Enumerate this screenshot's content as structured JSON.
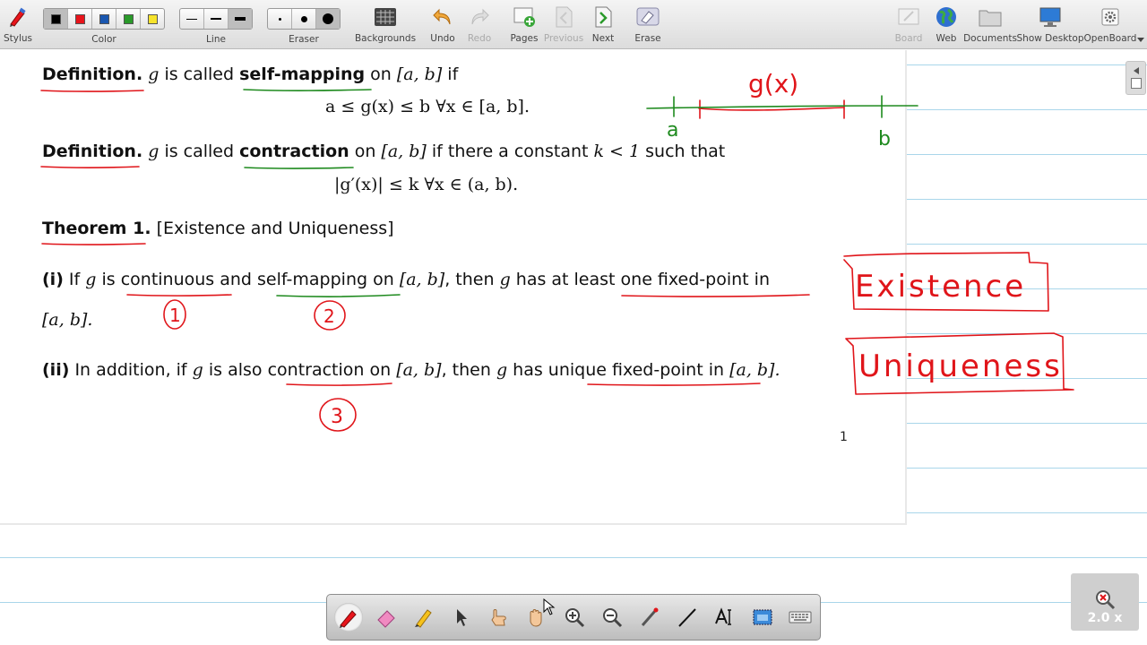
{
  "toolbar": {
    "stylus": "Stylus",
    "color": "Color",
    "line": "Line",
    "eraser": "Eraser",
    "backgrounds": "Backgrounds",
    "undo": "Undo",
    "redo": "Redo",
    "pages": "Pages",
    "previous": "Previous",
    "next": "Next",
    "erase": "Erase",
    "board": "Board",
    "web": "Web",
    "documents": "Documents",
    "show_desktop": "Show Desktop",
    "openboard": "OpenBoard",
    "colors": [
      "#000000",
      "#e8141b",
      "#1a57b0",
      "#2a9a2a",
      "#f6e32b"
    ]
  },
  "sheet": {
    "def1": {
      "label": "Definition.",
      "g": "g",
      "called": " is called ",
      "term": "self-mapping",
      "on": " on ",
      "interval": "[a, b]",
      "tail": " if",
      "formula": "a ≤ g(x) ≤ b   ∀x ∈ [a, b]."
    },
    "def2": {
      "label": "Definition.",
      "g": "g",
      "called": " is called ",
      "term": "contraction",
      "on": " on ",
      "interval": "[a, b]",
      "if_text": " if there a constant ",
      "k": "k < 1",
      "tail": " such that",
      "formula": "|g′(x)| ≤ k   ∀x ∈ (a, b)."
    },
    "theorem": {
      "label": "Theorem 1.",
      "title": " [Existence and Uniqueness]"
    },
    "part1": {
      "num": "(i)",
      "if": " If ",
      "g": "g",
      "is": " is ",
      "continuous": "continuous",
      "and": " and ",
      "self_mapping": "self-mapping",
      "on": " on ",
      "interval": "[a, b]",
      "then": ", then ",
      "g2": "g",
      "has": " has at ",
      "least": "least one fixed-point",
      "in": " in",
      "interval2": "[a, b]."
    },
    "part2": {
      "num": "(ii)",
      "text1": " In addition, if ",
      "g": "g",
      "text2": " is also ",
      "contraction": "contraction",
      "on": " on ",
      "interval": "[a, b]",
      "then": ", then ",
      "g2": "g",
      "has": " has ",
      "unique": "unique fixed-point",
      "in": " in ",
      "interval2": "[a, b]."
    },
    "page_number": "1"
  },
  "annotations": {
    "gx": "g(x)",
    "a": "a",
    "b": "b",
    "existence": "Existence",
    "uniqueness": "Uniqueness",
    "circle1": "1",
    "circle2": "2",
    "circle3": "3",
    "ink_red": "#e0151a",
    "ink_green": "#1e8a1e"
  },
  "zoom": {
    "level": "2.0 x"
  }
}
